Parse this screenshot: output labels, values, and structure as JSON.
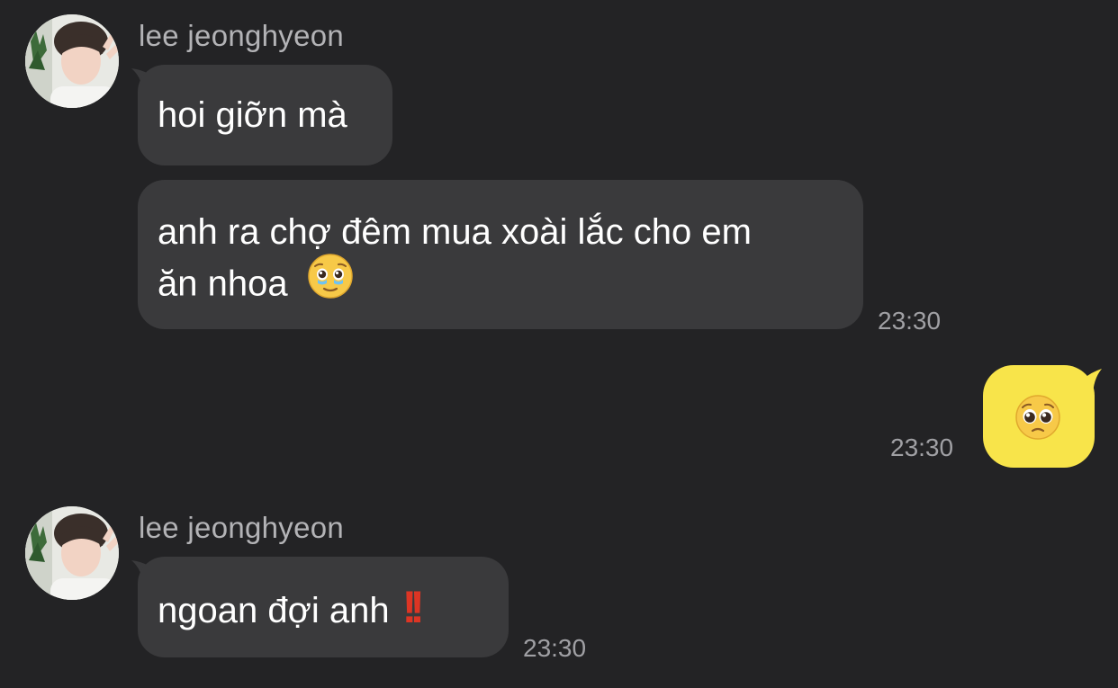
{
  "messages": [
    {
      "type": "incoming-group",
      "sender": "lee jeonghyeon",
      "bubbles": [
        {
          "text": "hoi giỡn mà"
        },
        {
          "line1": "anh ra chợ đêm mua xoài lắc cho em",
          "line2": "ăn nhoa",
          "emoji": "smiling-face-with-tear-emoji"
        }
      ],
      "time": "23:30"
    },
    {
      "type": "outgoing",
      "emoji": "pleading-face-emoji",
      "time": "23:30"
    },
    {
      "type": "incoming-group",
      "sender": "lee jeonghyeon",
      "bubbles": [
        {
          "text": "ngoan đợi anh",
          "emoji": "double-exclamation-emoji",
          "emoji_glyph": "!!"
        }
      ],
      "time": "23:30"
    }
  ],
  "colors": {
    "background": "#232325",
    "incoming_bubble": "#3a3a3c",
    "outgoing_bubble": "#f8e44a",
    "name_text": "#b3b3b6",
    "time_text": "#a0a0a4"
  }
}
